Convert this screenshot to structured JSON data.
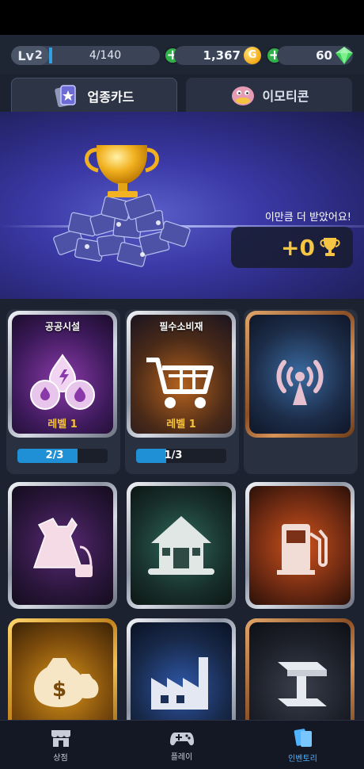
{
  "topbar": {
    "level_prefix": "Lv",
    "level": "2",
    "xp": "4/140",
    "xp_fraction": 0.029,
    "gold": "1,367",
    "gold_icon_letter": "G",
    "gems": "60"
  },
  "tabs": [
    {
      "label": "업종카드",
      "active": true
    },
    {
      "label": "이모티콘",
      "active": false
    }
  ],
  "banner": {
    "message": "이만큼 더 받았어요!",
    "reward": "+0"
  },
  "cards": [
    {
      "title": "공공시설",
      "level": "레벨 1",
      "progress": "2/3",
      "progress_fraction": 0.667,
      "frame": "silver",
      "icon": "utilities-icon"
    },
    {
      "title": "필수소비재",
      "level": "레벨 1",
      "progress": "1/3",
      "progress_fraction": 0.333,
      "frame": "silver",
      "icon": "shopping-cart-icon"
    },
    {
      "title": "",
      "level": "",
      "frame": "bronze",
      "icon": "antenna-icon"
    },
    {
      "title": "",
      "level": "",
      "frame": "silver",
      "icon": "dress-icon"
    },
    {
      "title": "",
      "level": "",
      "frame": "silver",
      "icon": "house-icon"
    },
    {
      "title": "",
      "level": "",
      "frame": "silver",
      "icon": "fuel-pump-icon"
    },
    {
      "title": "",
      "level": "",
      "frame": "gold",
      "icon": "money-bag-icon"
    },
    {
      "title": "",
      "level": "",
      "frame": "silver",
      "icon": "factory-icon"
    },
    {
      "title": "",
      "level": "",
      "frame": "bronze",
      "icon": "steel-icon"
    }
  ],
  "bottom_nav": [
    {
      "label": "상점",
      "icon": "shop-icon",
      "active": false
    },
    {
      "label": "플레이",
      "icon": "gamepad-icon",
      "active": false
    },
    {
      "label": "인벤토리",
      "icon": "cards-icon",
      "active": true
    }
  ],
  "colors": {
    "accent_blue": "#2fa2e6",
    "gold": "#f6c543",
    "green_plus": "#31b14a"
  }
}
